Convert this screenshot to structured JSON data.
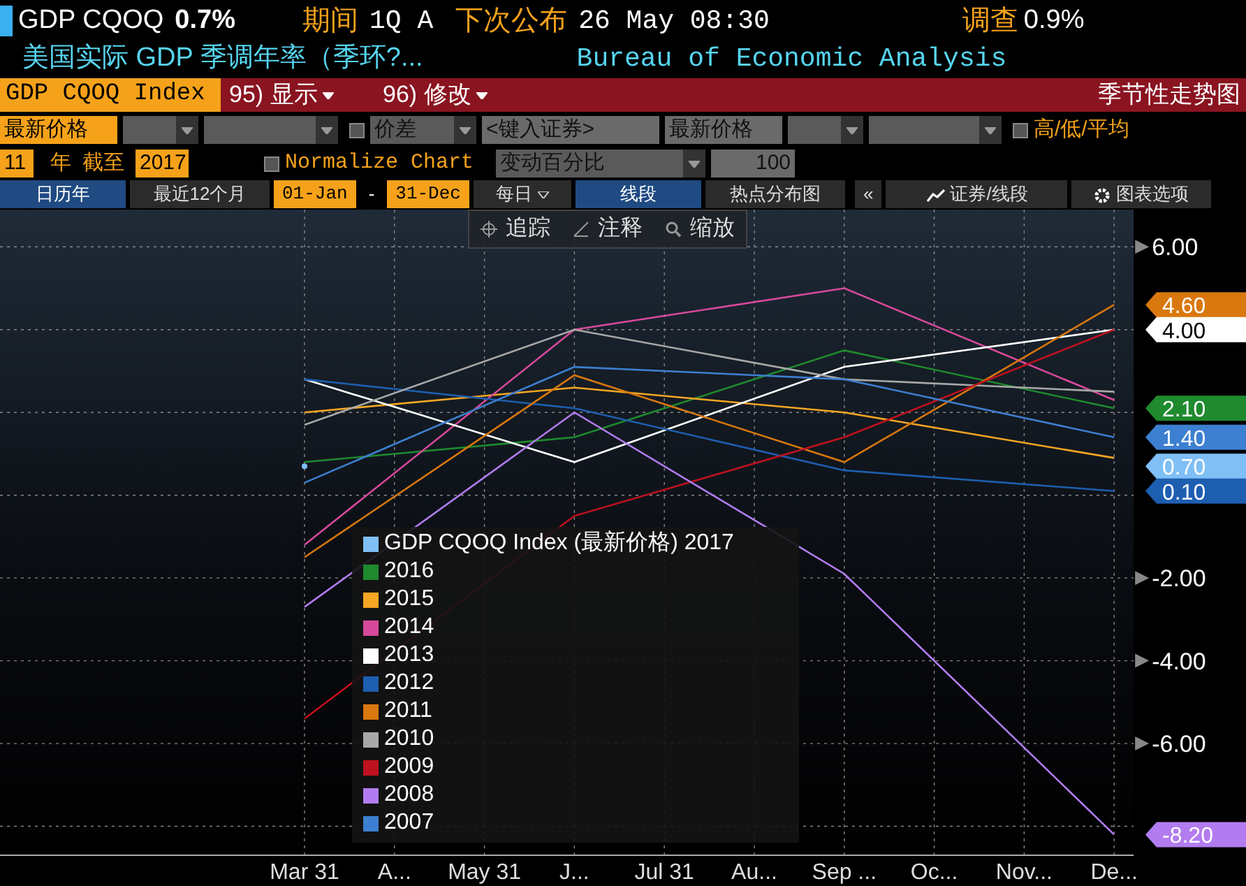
{
  "header": {
    "ticker": "GDP CQOQ",
    "value": "0.7%",
    "period_label": "期间",
    "period": "1Q A",
    "next_label": "下次公布",
    "next": "26 May 08:30",
    "survey_label": "调查",
    "survey": "0.9%",
    "subtitle": "美国实际 GDP 季调年率（季环?...",
    "source": "Bureau of Economic Analysis"
  },
  "command_bar": {
    "security": "GDP CQOQ Index",
    "menus": [
      {
        "number": "95)",
        "label": "显示"
      },
      {
        "number": "96)",
        "label": "修改"
      }
    ],
    "title": "季节性走势图"
  },
  "settings_row": [
    {
      "kind": "field",
      "value": "最新价格",
      "highlight": true
    },
    {
      "kind": "dropdown"
    },
    {
      "kind": "dropdown"
    },
    {
      "kind": "checkbox",
      "checked": false
    },
    {
      "kind": "dropdown",
      "value": "价差"
    },
    {
      "kind": "field",
      "value": "<键入证券>",
      "highlight": false
    },
    {
      "kind": "field",
      "value": "最新价格",
      "highlight": false
    },
    {
      "kind": "dropdown"
    },
    {
      "kind": "dropdown"
    },
    {
      "kind": "checkbox",
      "checked": false,
      "label": "高/低/平均"
    }
  ],
  "range_row": {
    "years": "11",
    "years_label": "年",
    "until_label": "截至",
    "until": "2017",
    "normalize": {
      "label": "Normalize Chart",
      "checked": false
    },
    "change_mode": "变动百分比",
    "base": "100"
  },
  "toolbar": [
    {
      "kind": "tab",
      "label": "日历年",
      "selected": true
    },
    {
      "kind": "tab",
      "label": "最近12个月",
      "selected": false
    },
    {
      "kind": "date",
      "label": "01-Jan"
    },
    {
      "kind": "sep",
      "label": "-"
    },
    {
      "kind": "date",
      "label": "31-Dec"
    },
    {
      "kind": "dropdown",
      "label": "每日"
    },
    {
      "kind": "tab",
      "label": "线段",
      "selected": true
    },
    {
      "kind": "tab",
      "label": "热点分布图",
      "selected": false
    },
    {
      "kind": "collapse",
      "label": "«"
    },
    {
      "kind": "securities",
      "label": "证券/线段"
    },
    {
      "kind": "options",
      "label": "图表选项"
    }
  ],
  "chart_tools": [
    {
      "kind": "crosshair",
      "label": "追踪"
    },
    {
      "kind": "annotate",
      "label": "注释"
    },
    {
      "kind": "zoom",
      "label": "缩放"
    }
  ],
  "chart": {
    "chart_data": {
      "type": "line",
      "categories": [
        "Mar 31",
        "A...",
        "May 31",
        "J...",
        "Jul 31",
        "Au...",
        "Sep ...",
        "Oc...",
        "Nov...",
        "De..."
      ],
      "ylim": [
        -8.7,
        6.9
      ],
      "grid": true,
      "legend": true,
      "yticks": [
        {
          "value": 6,
          "label": "6.00"
        },
        {
          "value": -2,
          "label": "-2.00"
        },
        {
          "value": -4,
          "label": "-4.00"
        },
        {
          "value": -6,
          "label": "-6.00"
        }
      ],
      "series": [
        {
          "name": "GDP CQOQ Index (最新价格) 2017",
          "color": "#7fbff5",
          "marker": "circle",
          "values": [
            0.7,
            null,
            null,
            null,
            null,
            null,
            null,
            null,
            null,
            null
          ]
        },
        {
          "name": "2016",
          "color": "#1f8a2e",
          "values": [
            0.8,
            null,
            null,
            1.4,
            null,
            null,
            3.5,
            null,
            null,
            2.1
          ]
        },
        {
          "name": "2015",
          "color": "#f5a623",
          "values": [
            2.0,
            null,
            null,
            2.6,
            null,
            null,
            2.0,
            null,
            null,
            0.9
          ]
        },
        {
          "name": "2014",
          "color": "#d6499a",
          "values": [
            -1.2,
            null,
            null,
            4.0,
            null,
            null,
            5.0,
            null,
            null,
            2.3
          ]
        },
        {
          "name": "2013",
          "color": "#ffffff",
          "values": [
            2.8,
            null,
            null,
            0.8,
            null,
            null,
            3.1,
            null,
            null,
            4.0
          ]
        },
        {
          "name": "2012",
          "color": "#1e5eb0",
          "values": [
            2.8,
            null,
            null,
            2.1,
            null,
            null,
            0.6,
            null,
            null,
            0.1
          ]
        },
        {
          "name": "2011",
          "color": "#d9780e",
          "values": [
            -1.5,
            null,
            null,
            2.9,
            null,
            null,
            0.8,
            null,
            null,
            4.6
          ]
        },
        {
          "name": "2010",
          "color": "#a8a8a8",
          "values": [
            1.7,
            null,
            null,
            4.0,
            null,
            null,
            2.8,
            null,
            null,
            2.5
          ]
        },
        {
          "name": "2009",
          "color": "#c0111f",
          "values": [
            -5.4,
            null,
            null,
            -0.5,
            null,
            null,
            1.4,
            null,
            null,
            4.0
          ]
        },
        {
          "name": "2008",
          "color": "#b27cf0",
          "values": [
            -2.7,
            null,
            null,
            2.0,
            null,
            null,
            -1.9,
            null,
            null,
            -8.2
          ]
        },
        {
          "name": "2007",
          "color": "#3d7fd0",
          "values": [
            0.3,
            null,
            null,
            3.1,
            null,
            null,
            2.8,
            null,
            null,
            1.4
          ]
        }
      ]
    },
    "value_tags": [
      {
        "text": "4.60",
        "color": "#d9780e"
      },
      {
        "text": "4.00",
        "color": "#ffffff"
      },
      {
        "text": "2.10",
        "color": "#1f8a2e"
      },
      {
        "text": "1.40",
        "color": "#3d7fd0"
      },
      {
        "text": "0.70",
        "color": "#7fbff5"
      },
      {
        "text": "0.10",
        "color": "#1e5eb0"
      },
      {
        "text": "-8.20",
        "color": "#b27cf0"
      }
    ]
  }
}
